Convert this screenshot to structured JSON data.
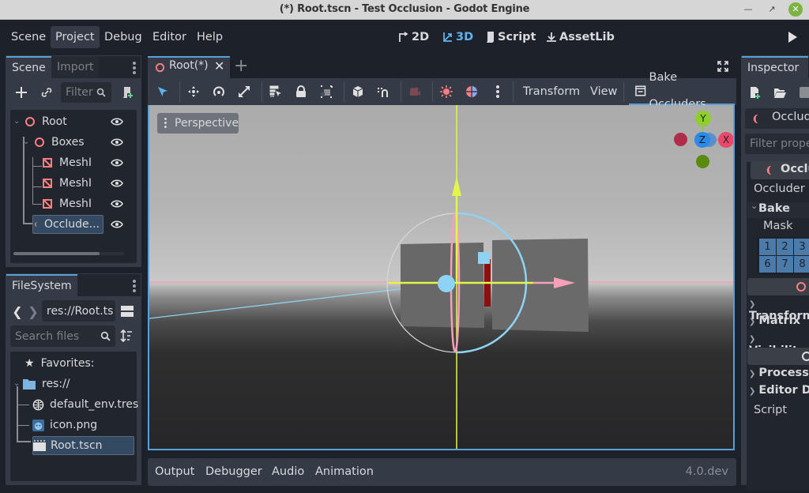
{
  "window": {
    "title": "(*) Root.tscn - Test Occlusion - Godot Engine"
  },
  "menubar": {
    "menus": [
      "Scene",
      "Project",
      "Debug",
      "Editor",
      "Help"
    ],
    "active_menu": "Project",
    "workspaces": [
      {
        "label": "2D",
        "icon": "2d-icon"
      },
      {
        "label": "3D",
        "icon": "3d-icon",
        "active": true
      },
      {
        "label": "Script",
        "icon": "script-icon"
      },
      {
        "label": "AssetLib",
        "icon": "download-icon"
      }
    ]
  },
  "scene_dock": {
    "tabs": [
      "Scene",
      "Import"
    ],
    "active_tab": "Scene",
    "filter_placeholder": "Filter",
    "tree": [
      {
        "label": "Root",
        "icon": "node3d-icon",
        "depth": 0,
        "expanded": true
      },
      {
        "label": "Boxes",
        "icon": "node3d-icon",
        "depth": 1,
        "expanded": true
      },
      {
        "label": "MeshI",
        "icon": "mesh-instance-icon",
        "depth": 2
      },
      {
        "label": "MeshI",
        "icon": "mesh-instance-icon",
        "depth": 2
      },
      {
        "label": "MeshI",
        "icon": "mesh-instance-icon",
        "depth": 2
      },
      {
        "label": "Occlude...",
        "icon": "occluder-icon",
        "depth": 1,
        "selected": true
      }
    ]
  },
  "filesystem_dock": {
    "tab": "FileSystem",
    "path": "res://Root.ts",
    "search_placeholder": "Search files",
    "favorites_label": "Favorites:",
    "root_label": "res://",
    "files": [
      {
        "name": "default_env.tres",
        "icon": "environment-icon"
      },
      {
        "name": "icon.png",
        "icon": "image-icon"
      },
      {
        "name": "Root.tscn",
        "icon": "scene-file-icon",
        "selected": true
      }
    ]
  },
  "editor": {
    "tab_label": "Root(*)",
    "toolbar": {
      "transform_label": "Transform",
      "view_label": "View",
      "bake_label": "Bake Occluders"
    },
    "viewport": {
      "perspective_label": "Perspective",
      "gizmo_axes": [
        "Y",
        "Z",
        "X"
      ]
    }
  },
  "bottom_panel": {
    "tabs": [
      "Output",
      "Debugger",
      "Audio",
      "Animation"
    ],
    "version": "4.0.dev"
  },
  "inspector": {
    "tab": "Inspector",
    "object_name": "Occlude",
    "filter_placeholder": "Filter prope",
    "class_header": "Occlu",
    "occluder_label": "Occluder",
    "bake_group": "Bake",
    "mask_label": "Mask",
    "mask_cells": [
      "1",
      "2",
      "3",
      "6",
      "7",
      "8"
    ],
    "groups": [
      "Transform",
      "Matrix",
      "Visibility",
      "Process",
      "Editor De"
    ],
    "script_label": "Script"
  },
  "colors": {
    "accent": "#5a9fd6",
    "node3d": "#fc7f7f",
    "x_axis": "#f7768e",
    "y_axis": "#8fcf2c",
    "z_axis": "#3a8ae8",
    "mask_bit": "#4a7bab"
  }
}
